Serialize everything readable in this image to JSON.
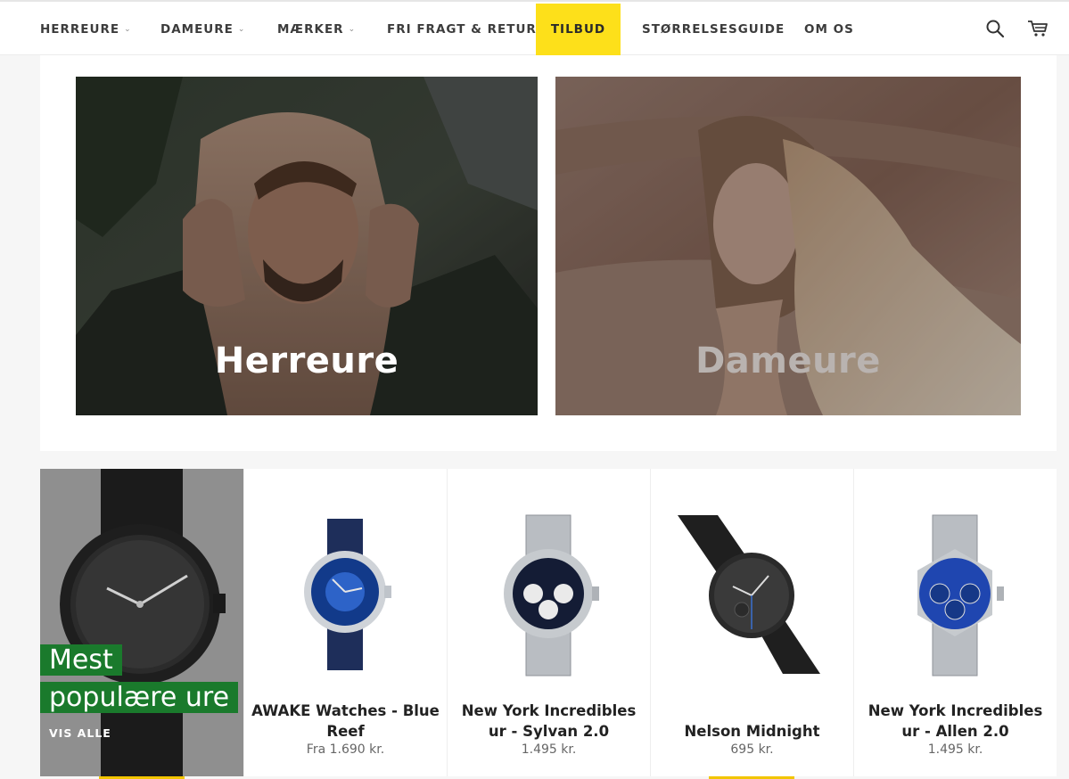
{
  "nav": {
    "items": [
      {
        "label": "HERREURE",
        "has_dropdown": true
      },
      {
        "label": "DAMEURE",
        "has_dropdown": true
      },
      {
        "label": "MÆRKER",
        "has_dropdown": true
      },
      {
        "label": "FRI FRAGT & RETUR",
        "has_dropdown": false
      },
      {
        "label": "TILBUD",
        "has_dropdown": false,
        "highlight": true
      },
      {
        "label": "STØRRELSESGUIDE",
        "has_dropdown": false
      },
      {
        "label": "OM OS",
        "has_dropdown": false
      }
    ],
    "caret_glyph": "⌄",
    "icons": [
      "search-icon",
      "cart-icon"
    ],
    "highlight_color": "#fde01a"
  },
  "hero": {
    "mens_title": "Herreure",
    "womens_title": "Dameure"
  },
  "featured": {
    "heading_line1": "Mest",
    "heading_line2": "populære ure",
    "link_label": "VIS ALLE",
    "accent_color": "#1a7a2c"
  },
  "products": [
    {
      "name": "AWAKE Watches - Blue Reef",
      "price": "Fra 1.690 kr."
    },
    {
      "name": "New York Incredibles ur - Sylvan 2.0",
      "price": "1.495 kr."
    },
    {
      "name": "Nelson Midnight",
      "price": "695 kr."
    },
    {
      "name": "New York Incredibles ur - Allen 2.0",
      "price": "1.495 kr."
    }
  ]
}
